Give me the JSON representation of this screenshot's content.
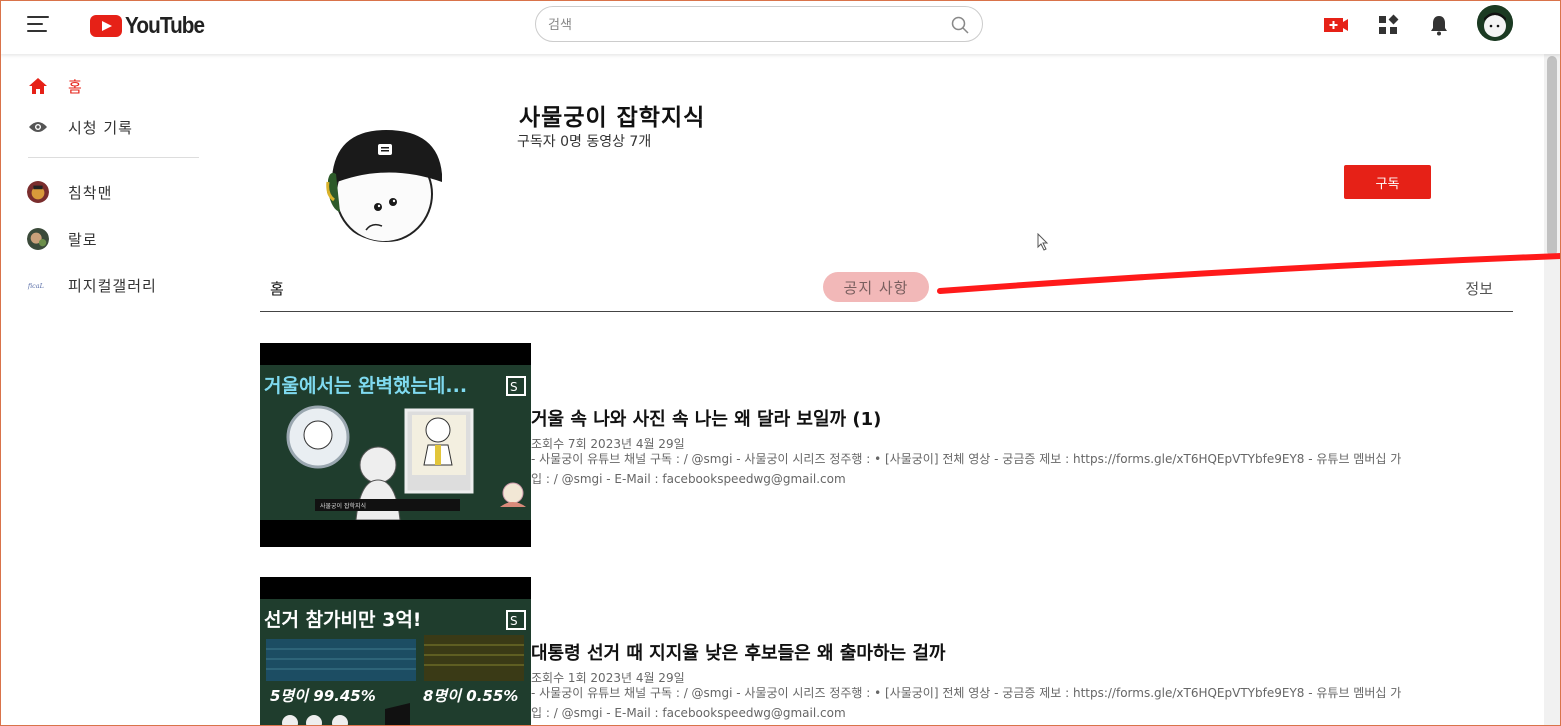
{
  "header": {
    "logo_text": "YouTube",
    "search_placeholder": "검색"
  },
  "sidebar": {
    "items": [
      {
        "label": "홈",
        "icon": "home-icon",
        "active": true
      },
      {
        "label": "시청 기록",
        "icon": "eye-icon",
        "active": false
      }
    ],
    "subscriptions": [
      {
        "label": "침착맨"
      },
      {
        "label": "랄로"
      },
      {
        "label": "피지컬갤러리"
      }
    ]
  },
  "channel": {
    "name": "사물궁이 잡학지식",
    "stats": "구독자 0명 동영상 7개",
    "subscribe_label": "구독"
  },
  "tabs": {
    "home": "홈",
    "notice": "공지 사항",
    "info": "정보"
  },
  "videos": [
    {
      "thumb_text": "거울에서는 완벽했는데...",
      "title": "거울 속 나와 사진 속 나는 왜 달라 보일까 (1)",
      "meta": "조회수 7회 2023년 4월 29일",
      "desc_line1": "- 사물궁이 유튜브 채널 구독 : / @smgi - 사물궁이 시리즈 정주행 : • [사물궁이] 전체 영상 - 궁금증 제보 : https://forms.gle/xT6HQEpVTYbfe9EY8 - 유튜브 멤버십 가",
      "desc_line2": "입 : / @smgi - E-Mail : facebookspeedwg@gmail.com"
    },
    {
      "thumb_text": "선거 참가비만 3억!",
      "thumb_left": "5명이 99.45%",
      "thumb_right": "8명이 0.55%",
      "title": "대통령 선거 때 지지율 낮은 후보들은 왜 출마하는 걸까",
      "meta": "조회수 1회 2023년 4월 29일",
      "desc_line1": "- 사물궁이 유튜브 채널 구독 : / @smgi - 사물궁이 시리즈 정주행 : • [사물궁이] 전체 영상 - 궁금증 제보 : https://forms.gle/xT6HQEpVTYbfe9EY8 - 유튜브 멤버십 가",
      "desc_line2": "입 : / @smgi - E-Mail : facebookspeedwg@gmail.com"
    }
  ],
  "colors": {
    "brand_red": "#e62117",
    "annotation_red": "#ff1a1a",
    "notice_highlight": "#f2b8b8"
  }
}
